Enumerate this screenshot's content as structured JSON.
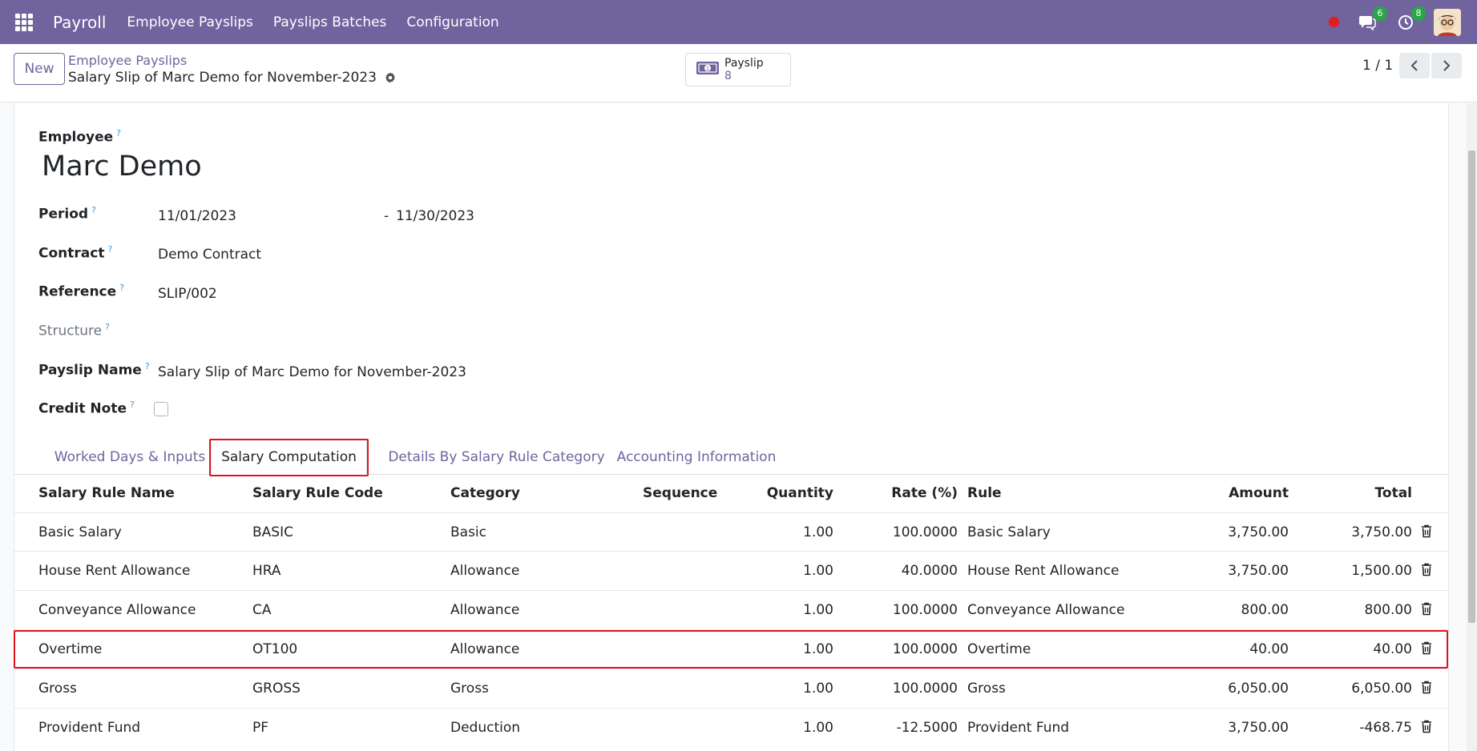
{
  "navbar": {
    "app_title": "Payroll",
    "menu": [
      "Employee Payslips",
      "Payslips Batches",
      "Configuration"
    ],
    "messages_count": "6",
    "activities_count": "8",
    "icons": [
      "apps-grid-icon",
      "recording-dot-icon",
      "chat-icon",
      "clock-icon",
      "user-avatar"
    ]
  },
  "controlbar": {
    "new_label": "New",
    "breadcrumb_parent": "Employee Payslips",
    "breadcrumb_current": "Salary Slip of Marc Demo for November-2023",
    "smart_button": {
      "label": "Payslip",
      "value": "8",
      "icon": "money-icon"
    },
    "pager": "1 / 1"
  },
  "form": {
    "employee_label": "Employee",
    "employee_name": "Marc Demo",
    "help_mark": "?",
    "period_label": "Period",
    "period_from": "11/01/2023",
    "period_sep": "-",
    "period_to": "11/30/2023",
    "contract_label": "Contract",
    "contract_value": "Demo Contract",
    "reference_label": "Reference",
    "reference_value": "SLIP/002",
    "structure_label": "Structure",
    "payslip_name_label": "Payslip Name",
    "payslip_name_value": "Salary Slip of Marc Demo for November-2023",
    "credit_note_label": "Credit Note"
  },
  "tabs": [
    "Worked Days & Inputs",
    "Salary Computation",
    "Details By Salary Rule Category",
    "Accounting Information"
  ],
  "table": {
    "headers": [
      "Salary Rule Name",
      "Salary Rule Code",
      "Category",
      "Sequence",
      "Quantity",
      "Rate (%)",
      "Rule",
      "Amount",
      "Total"
    ],
    "rows": [
      {
        "name": "Basic Salary",
        "code": "BASIC",
        "category": "Basic",
        "sequence": "",
        "quantity": "1.00",
        "rate": "100.0000",
        "rule": "Basic Salary",
        "amount": "3,750.00",
        "total": "3,750.00"
      },
      {
        "name": "House Rent Allowance",
        "code": "HRA",
        "category": "Allowance",
        "sequence": "",
        "quantity": "1.00",
        "rate": "40.0000",
        "rule": "House Rent Allowance",
        "amount": "3,750.00",
        "total": "1,500.00"
      },
      {
        "name": "Conveyance Allowance",
        "code": "CA",
        "category": "Allowance",
        "sequence": "",
        "quantity": "1.00",
        "rate": "100.0000",
        "rule": "Conveyance Allowance",
        "amount": "800.00",
        "total": "800.00"
      },
      {
        "name": "Overtime",
        "code": "OT100",
        "category": "Allowance",
        "sequence": "",
        "quantity": "1.00",
        "rate": "100.0000",
        "rule": "Overtime",
        "amount": "40.00",
        "total": "40.00"
      },
      {
        "name": "Gross",
        "code": "GROSS",
        "category": "Gross",
        "sequence": "",
        "quantity": "1.00",
        "rate": "100.0000",
        "rule": "Gross",
        "amount": "6,050.00",
        "total": "6,050.00"
      },
      {
        "name": "Provident Fund",
        "code": "PF",
        "category": "Deduction",
        "sequence": "",
        "quantity": "1.00",
        "rate": "-12.5000",
        "rule": "Provident Fund",
        "amount": "3,750.00",
        "total": "-468.75"
      }
    ]
  },
  "colors": {
    "brand": "#71639e",
    "highlight": "#e0141e",
    "help": "#3c9bd7"
  }
}
